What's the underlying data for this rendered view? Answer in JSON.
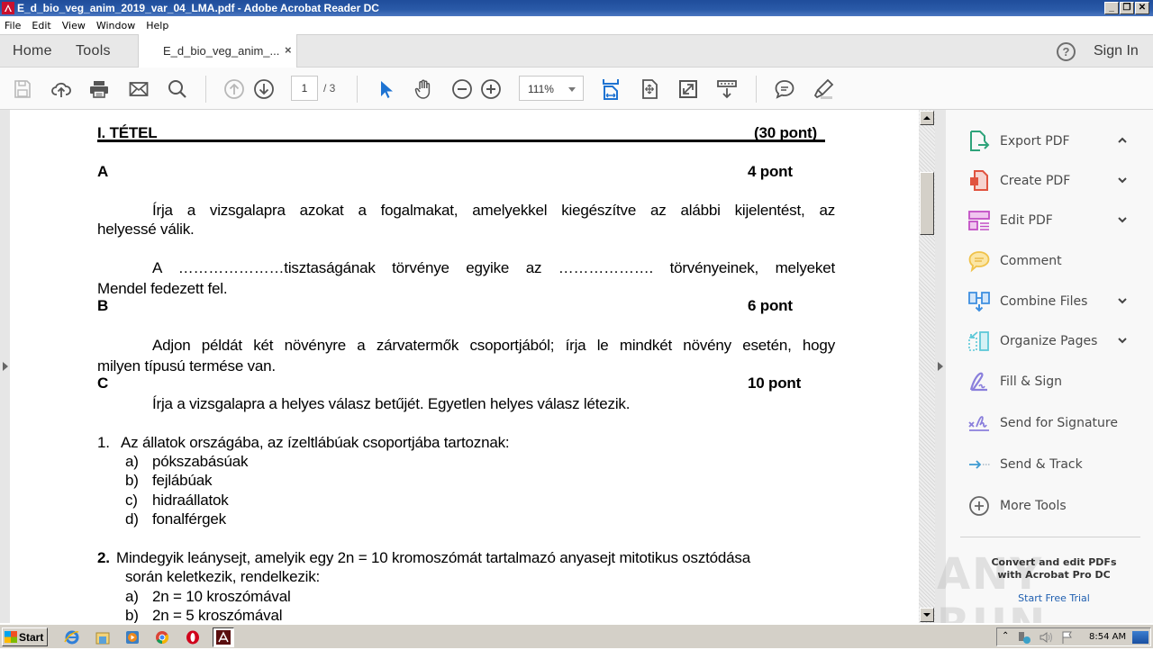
{
  "window": {
    "title": "E_d_bio_veg_anim_2019_var_04_LMA.pdf - Adobe Acrobat Reader DC",
    "controls": {
      "minimize": "_",
      "restore": "❐",
      "close": "✕"
    }
  },
  "menu": [
    "File",
    "Edit",
    "View",
    "Window",
    "Help"
  ],
  "tabs": {
    "home": "Home",
    "tools": "Tools",
    "document": "E_d_bio_veg_anim_...",
    "close": "×",
    "help_icon": "?",
    "sign_in": "Sign In"
  },
  "toolbar": {
    "page_current": "1",
    "page_total": "/ 3",
    "zoom": "111%"
  },
  "document": {
    "tetel_title": "I. TÉTEL",
    "tetel_points": "(30 pont)",
    "sections": {
      "A": {
        "label": "A",
        "points": "4 pont",
        "instruction_line1": "Írja a vizsgalapra azokat a fogalmakat, amelyekkel kiegészítve az alábbi kijelentést, az",
        "instruction_line2": "helyessé válik.",
        "statement_line1": "A …………………tisztaságának törvénye egyike az ………………. törvényeinek, melyeket",
        "statement_line2": "Mendel fedezett fel."
      },
      "B": {
        "label": "B",
        "points": "6 pont",
        "instruction_line1": "Adjon példát két növényre a zárvatermők csoportjából; írja le mindkét növény esetén, hogy",
        "instruction_line2": "milyen típusú termése van."
      },
      "C": {
        "label": "C",
        "points": "10 pont",
        "instruction": "Írja a vizsgalapra a helyes válasz betűjét. Egyetlen helyes válasz létezik.",
        "questions": [
          {
            "number": "1.",
            "text": "Az állatok országába, az ízeltlábúak csoportjába tartoznak:",
            "options": [
              {
                "letter": "a)",
                "text": "pókszabásúak"
              },
              {
                "letter": "b)",
                "text": "fejlábúak"
              },
              {
                "letter": "c)",
                "text": "hidraállatok"
              },
              {
                "letter": "d)",
                "text": "fonalférgek"
              }
            ]
          },
          {
            "number": "2.",
            "text_line1": "Mindegyik leánysejt, amelyik egy 2n = 10 kromoszómát tartalmazó anyasejt mitotikus osztódása",
            "text_line2": "során keletkezik, rendelkezik:",
            "options": [
              {
                "letter": "a)",
                "text": "2n = 10 kroszómával"
              },
              {
                "letter": "b)",
                "text": "2n = 5 kroszómával"
              }
            ]
          }
        ]
      }
    }
  },
  "right_panel": {
    "items": [
      {
        "label": "Export PDF",
        "icon": "export-pdf-icon",
        "chevron": "up"
      },
      {
        "label": "Create PDF",
        "icon": "create-pdf-icon",
        "chevron": "down"
      },
      {
        "label": "Edit PDF",
        "icon": "edit-pdf-icon",
        "chevron": "down"
      },
      {
        "label": "Comment",
        "icon": "comment-icon",
        "chevron": ""
      },
      {
        "label": "Combine Files",
        "icon": "combine-files-icon",
        "chevron": "down"
      },
      {
        "label": "Organize Pages",
        "icon": "organize-pages-icon",
        "chevron": "down"
      },
      {
        "label": "Fill & Sign",
        "icon": "fill-sign-icon",
        "chevron": ""
      },
      {
        "label": "Send for Signature",
        "icon": "send-signature-icon",
        "chevron": ""
      },
      {
        "label": "Send & Track",
        "icon": "send-track-icon",
        "chevron": ""
      },
      {
        "label": "More Tools",
        "icon": "more-tools-icon",
        "chevron": ""
      }
    ],
    "promo_line1": "Convert and edit PDFs",
    "promo_line2": "with Acrobat Pro DC",
    "trial_link": "Start Free Trial",
    "watermark": "ANY RUN"
  },
  "taskbar": {
    "start": "Start",
    "clock": "8:54 AM"
  }
}
